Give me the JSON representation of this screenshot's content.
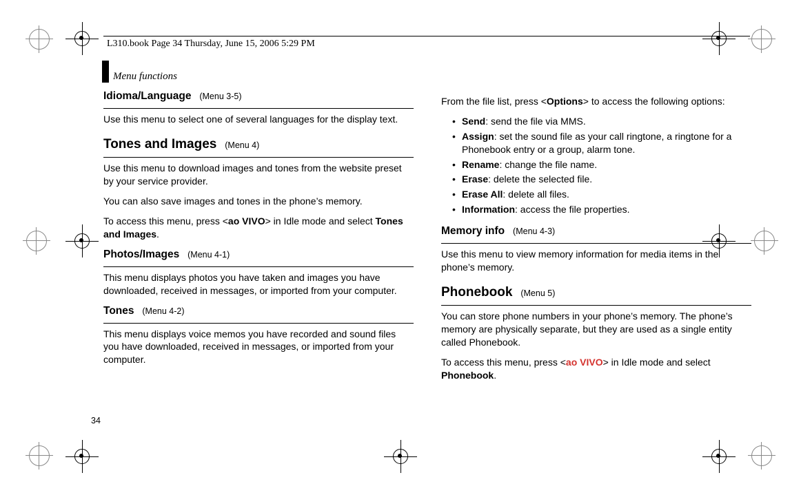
{
  "page_header": "L310.book  Page 34  Thursday, June 15, 2006  5:29 PM",
  "section_label": "Menu functions",
  "page_number": "34",
  "left": {
    "idioma": {
      "title": "Idioma/Language",
      "ref": "(Menu 3-5)",
      "body": "Use this menu to select one of several languages for the display text."
    },
    "tones_images": {
      "title": "Tones and Images",
      "ref": "(Menu 4)",
      "p1": "Use this menu to download images and tones from the website preset by your service provider.",
      "p2": "You can also save images and tones in the phone’s memory.",
      "p3a": "To access this menu, press <",
      "p3b": "ao VIVO",
      "p3c": "> in Idle mode and select ",
      "p3d": "Tones and Images",
      "p3e": "."
    },
    "photos": {
      "title": "Photos/Images",
      "ref": "(Menu 4-1)",
      "body": "This menu displays photos you have taken and images you have downloaded, received in messages, or imported from your computer."
    },
    "tones": {
      "title": "Tones",
      "ref": "(Menu 4-2)",
      "body": "This menu displays voice memos you have recorded and sound files you have downloaded, received in messages, or imported from your computer."
    }
  },
  "right": {
    "intro_a": "From the file list, press <",
    "intro_b": "Options",
    "intro_c": "> to access the following options:",
    "options": [
      {
        "name": "Send",
        "desc": ": send the file via MMS."
      },
      {
        "name": "Assign",
        "desc": ": set the sound file as your call ringtone, a ringtone for a Phonebook entry or a group, alarm tone."
      },
      {
        "name": "Rename",
        "desc": ": change the file name."
      },
      {
        "name": "Erase",
        "desc": ": delete the selected file."
      },
      {
        "name": "Erase All",
        "desc": ": delete all files."
      },
      {
        "name": "Information",
        "desc": ": access the file properties."
      }
    ],
    "memory": {
      "title": "Memory info",
      "ref": "(Menu 4-3)",
      "body": "Use this menu to view memory information for media items in the phone’s memory."
    },
    "phonebook": {
      "title": "Phonebook",
      "ref": "(Menu 5)",
      "p1": "You can store phone numbers in your phone’s memory. The phone’s memory are physically separate, but they are used as a single entity called Phonebook.",
      "p2a": "To access this menu, press <",
      "p2b": "ao VIVO",
      "p2c": "> in Idle mode and select ",
      "p2d": "Phonebook",
      "p2e": "."
    }
  }
}
